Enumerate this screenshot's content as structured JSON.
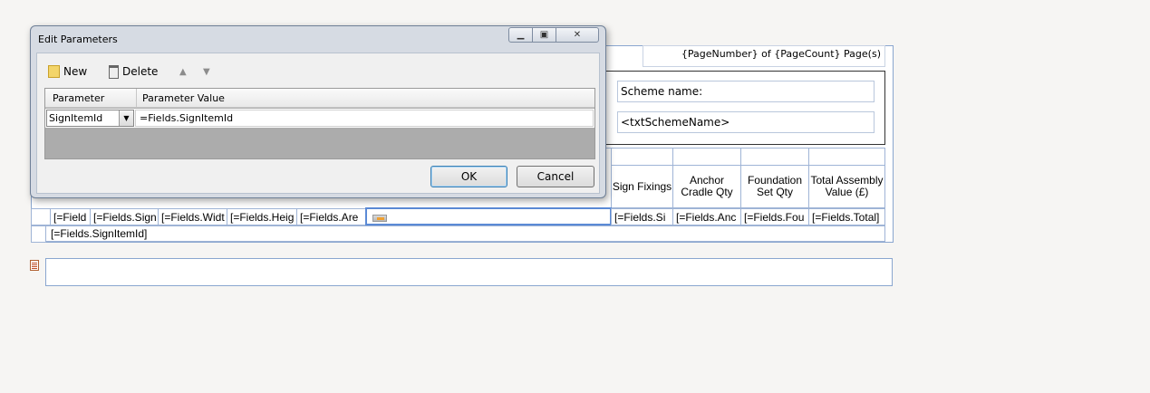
{
  "dialog": {
    "title": "Edit Parameters",
    "toolbar": {
      "new_label": "New",
      "delete_label": "Delete"
    },
    "grid": {
      "headers": [
        "Parameter",
        "Parameter Value"
      ],
      "rows": [
        {
          "parameter": "SignItemId",
          "value": "=Fields.SignItemId"
        }
      ]
    },
    "ok_label": "OK",
    "cancel_label": "Cancel"
  },
  "report": {
    "page_number_text": "{PageNumber} of {PageCount} Page(s)",
    "scheme_label": "Scheme name:",
    "scheme_field": "<txtSchemeName>",
    "column_headers": [
      "Sign Fixings",
      "Anchor Cradle Qty",
      "Foundation Set Qty",
      "Total Assembly Value (£)"
    ],
    "data_cells": [
      "[=Field",
      "[=Fields.Sign",
      "[=Fields.Widt",
      "[=Fields.Heig",
      "[=Fields.Are",
      "",
      "[=Fields.Si",
      "[=Fields.Anc",
      "[=Fields.Fou",
      "[=Fields.Total]"
    ],
    "group_row_text": "[=Fields.SignItemId]"
  },
  "colors": {
    "selection_border": "#5b8ad6",
    "grid_lines": "#9fb4d6",
    "dialog_frame": "#d6dbe3"
  }
}
